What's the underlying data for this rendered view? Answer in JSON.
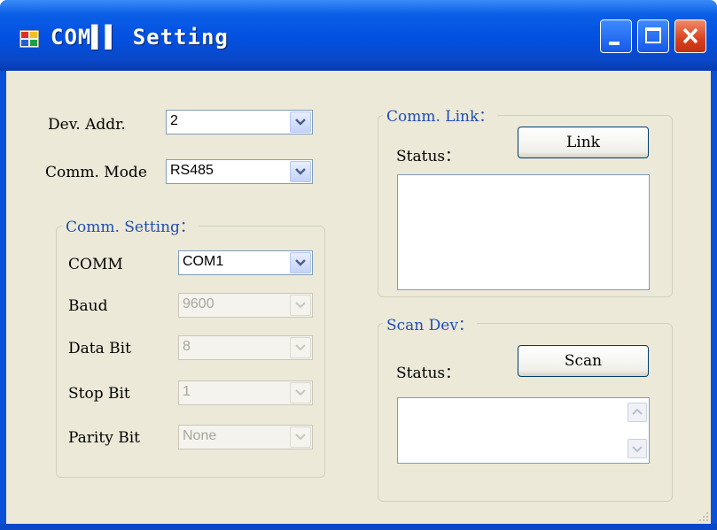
{
  "window": {
    "title": "COM▌▌ Setting"
  },
  "main": {
    "dev_addr": {
      "label": "Dev. Addr.",
      "value": "2"
    },
    "comm_mode": {
      "label": "Comm. Mode",
      "value": "RS485"
    }
  },
  "comm_setting": {
    "title": "Comm. Setting：",
    "comm": {
      "label": "COMM",
      "value": "COM1"
    },
    "baud": {
      "label": "Baud",
      "value": "9600"
    },
    "data_bit": {
      "label": "Data Bit",
      "value": "8"
    },
    "stop_bit": {
      "label": "Stop Bit",
      "value": "1"
    },
    "parity_bit": {
      "label": "Parity Bit",
      "value": "None"
    }
  },
  "comm_link": {
    "title": "Comm. Link：",
    "status_label": "Status：",
    "button_label": "Link"
  },
  "scan_dev": {
    "title": "Scan Dev：",
    "status_label": "Status：",
    "button_label": "Scan"
  },
  "colors": {
    "accent": "#0a50d8",
    "group_title": "#1f4db3",
    "client_bg": "#ece9d8"
  }
}
